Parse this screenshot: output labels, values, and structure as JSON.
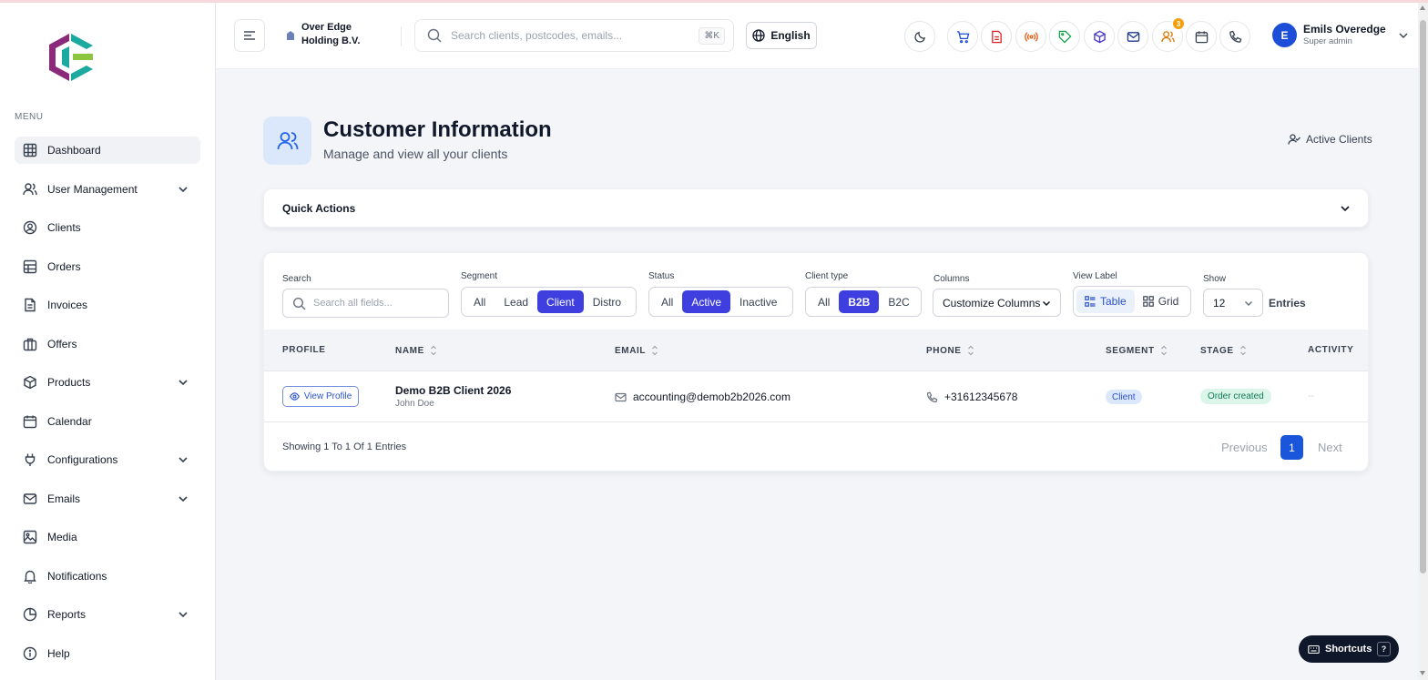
{
  "company": {
    "name": "Over Edge Holding B.V."
  },
  "sidebar": {
    "menu_label": "MENU",
    "items": [
      {
        "label": "Dashboard",
        "icon": "grid-icon",
        "active": true,
        "expandable": false
      },
      {
        "label": "User Management",
        "icon": "users-icon",
        "active": false,
        "expandable": true
      },
      {
        "label": "Clients",
        "icon": "user-circle-icon",
        "active": false,
        "expandable": false
      },
      {
        "label": "Orders",
        "icon": "table-icon",
        "active": false,
        "expandable": false
      },
      {
        "label": "Invoices",
        "icon": "document-icon",
        "active": false,
        "expandable": false
      },
      {
        "label": "Offers",
        "icon": "briefcase-icon",
        "active": false,
        "expandable": false
      },
      {
        "label": "Products",
        "icon": "box-icon",
        "active": false,
        "expandable": true
      },
      {
        "label": "Calendar",
        "icon": "calendar-icon",
        "active": false,
        "expandable": false
      },
      {
        "label": "Configurations",
        "icon": "plug-icon",
        "active": false,
        "expandable": true
      },
      {
        "label": "Emails",
        "icon": "mail-icon",
        "active": false,
        "expandable": true
      },
      {
        "label": "Media",
        "icon": "image-icon",
        "active": false,
        "expandable": false
      },
      {
        "label": "Notifications",
        "icon": "bell-icon",
        "active": false,
        "expandable": false
      },
      {
        "label": "Reports",
        "icon": "pie-chart-icon",
        "active": false,
        "expandable": true
      },
      {
        "label": "Help",
        "icon": "info-icon",
        "active": false,
        "expandable": false
      }
    ]
  },
  "header": {
    "search_placeholder": "Search clients, postcodes, emails...",
    "search_shortcut": "⌘K",
    "language": "English",
    "notification_count": "3",
    "user_initial": "E",
    "user_name": "Emils Overedge",
    "user_role": "Super admin"
  },
  "page": {
    "title": "Customer Information",
    "subtitle": "Manage and view all your clients",
    "active_clients": "Active Clients",
    "quick_actions": "Quick Actions"
  },
  "filters": {
    "search_label": "Search",
    "search_placeholder": "Search all fields...",
    "segment_label": "Segment",
    "segment_options": [
      "All",
      "Lead",
      "Client",
      "Distro"
    ],
    "segment_selected": "Client",
    "status_label": "Status",
    "status_options": [
      "All",
      "Active",
      "Inactive"
    ],
    "status_selected": "Active",
    "client_type_label": "Client type",
    "client_type_options": [
      "All",
      "B2B",
      "B2C"
    ],
    "client_type_selected": "B2B",
    "columns_label": "Columns",
    "columns_value": "Customize Columns",
    "view_label": "View Label",
    "view_table": "Table",
    "view_grid": "Grid",
    "view_selected": "Table",
    "show_label": "Show",
    "show_value": "12",
    "entries_label": "Entries"
  },
  "table": {
    "headers": [
      "PROFILE",
      "NAME",
      "EMAIL",
      "PHONE",
      "SEGMENT",
      "STAGE",
      "ACTIVITY"
    ],
    "rows": [
      {
        "profile_button": "View Profile",
        "name": "Demo B2B Client 2026",
        "contact": "John Doe",
        "email": "accounting@demob2b2026.com",
        "phone": "+31612345678",
        "segment": "Client",
        "stage": "Order created",
        "activity": "--"
      }
    ]
  },
  "pagination": {
    "summary": "Showing 1 To 1 Of 1 Entries",
    "previous": "Previous",
    "current_page": "1",
    "next": "Next"
  },
  "shortcuts": {
    "label": "Shortcuts",
    "key": "?"
  },
  "colors": {
    "accent": "#3f3fe0",
    "primary_blue": "#1a56db",
    "logo_purple": "#8b2a7a",
    "logo_teal": "#1ba9a0",
    "logo_green": "#8cc63f"
  }
}
